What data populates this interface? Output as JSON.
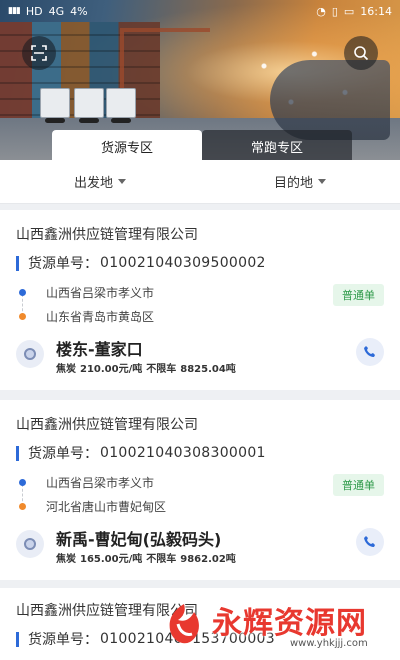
{
  "status_bar": {
    "signal_left": "HD",
    "network": "4G",
    "percent": "4%",
    "time": "16:14"
  },
  "tabs": [
    {
      "label": "货源专区",
      "active": true
    },
    {
      "label": "常跑专区",
      "active": false
    }
  ],
  "filters": {
    "origin": "出发地",
    "destination": "目的地"
  },
  "order_label": "货源单号：",
  "cards": [
    {
      "company": "山西鑫洲供应链管理有限公司",
      "order_no": "010021040309500002",
      "from": "山西省吕梁市孝义市",
      "to": "山东省青岛市黄岛区",
      "badge": "普通单",
      "line": "楼东-董家口",
      "cargo": "焦炭",
      "price": "210.00元/吨",
      "vehicle": "不限车",
      "weight": "8825.04吨"
    },
    {
      "company": "山西鑫洲供应链管理有限公司",
      "order_no": "010021040308300001",
      "from": "山西省吕梁市孝义市",
      "to": "河北省唐山市曹妃甸区",
      "badge": "普通单",
      "line": "新禹-曹妃甸(弘毅码头)",
      "cargo": "焦炭",
      "price": "165.00元/吨",
      "vehicle": "不限车",
      "weight": "9862.02吨"
    },
    {
      "company": "山西鑫洲供应链管理有限公司",
      "order_no": "0100210407153700003"
    }
  ],
  "watermark": {
    "text": "永辉资源网",
    "url": "www.yhkjjj.com"
  },
  "colors": {
    "accent_blue": "#2d6ad8",
    "to_orange": "#f08a2c",
    "badge_green": "#2f9a4a",
    "watermark_red": "#e8382f"
  }
}
